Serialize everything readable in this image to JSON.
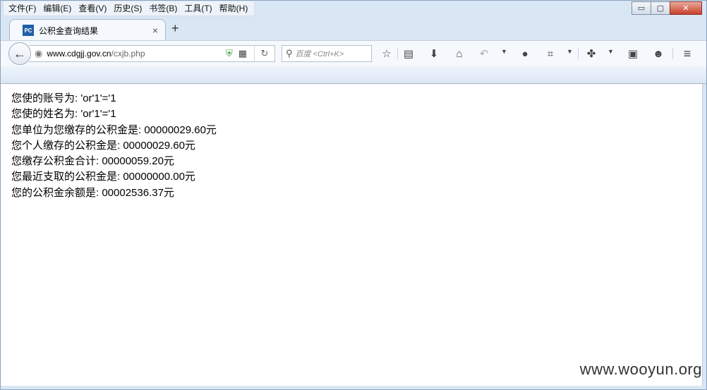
{
  "menubar": {
    "items": [
      "文件(F)",
      "编辑(E)",
      "查看(V)",
      "历史(S)",
      "书签(B)",
      "工具(T)",
      "帮助(H)"
    ]
  },
  "window_controls": {
    "minimize": "▭",
    "maximize": "▢",
    "close": "✕"
  },
  "tab": {
    "favicon_text": "PC",
    "title": "公积金查询结果",
    "close": "×",
    "new_tab": "+"
  },
  "toolbar": {
    "url_host": "www.cdgjj.gov.cn",
    "url_path": "/cxjb.php",
    "search_placeholder": "百度 <Ctrl+K>"
  },
  "icons": [
    "back-icon",
    "globe-icon",
    "shield-icon",
    "qr-code-icon",
    "reload-icon",
    "search-icon",
    "bookmark-star-icon",
    "reading-list-icon",
    "download-icon",
    "home-icon",
    "undo-icon",
    "chat-icon",
    "screenshot-crop-icon",
    "tools-icon",
    "robot-icon",
    "smiley-icon",
    "menu-icon"
  ],
  "content": {
    "lines": [
      "您使的账号为: 'or'1'='1",
      "您使的姓名为: 'or'1'='1",
      "您单位为您缴存的公积金是: 00000029.60元",
      "您个人缴存的公积金是: 00000029.60元",
      "您缴存公积金合计: 00000059.20元",
      "您最近支取的公积金是: 00000000.00元",
      "您的公积金余额是: 00002536.37元"
    ],
    "watermark": "www.wooyun.org"
  }
}
